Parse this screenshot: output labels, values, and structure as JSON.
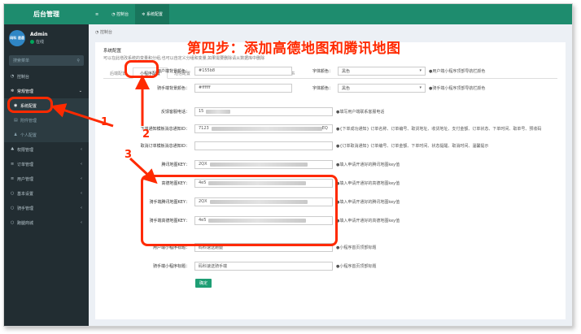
{
  "app": {
    "title": "后台管理"
  },
  "user": {
    "avatar_text": "码科 速通",
    "name": "Admin",
    "status": "在线"
  },
  "sidebar": {
    "search_placeholder": "搜索菜单",
    "items": [
      {
        "label": "控制台",
        "icon": "dashboard-icon"
      },
      {
        "label": "常规管理",
        "icon": "gears-icon"
      },
      {
        "label": "系统配置",
        "icon": "circle-icon"
      },
      {
        "label": "附件管理",
        "icon": "file-icon"
      },
      {
        "label": "个人配置",
        "icon": "user-icon"
      },
      {
        "label": "权限管理",
        "icon": "group-icon"
      },
      {
        "label": "订单管理",
        "icon": "list-icon"
      },
      {
        "label": "用户管理",
        "icon": "list-icon"
      },
      {
        "label": "基本设置",
        "icon": "circle-icon"
      },
      {
        "label": "骑手管理",
        "icon": "circle-icon"
      },
      {
        "label": "跑腿商城",
        "icon": "circle-icon"
      }
    ]
  },
  "header": {
    "tabs": [
      {
        "label": "控制台"
      },
      {
        "label": "系统配置"
      }
    ]
  },
  "breadcrumb": "控制台",
  "panel": {
    "title": "系统配置",
    "desc": "可以在此增改系统的变量和分组,也可以自定义分组和变量,如果需要删除请从数据库中删除",
    "tabs": [
      "后端配置",
      "小程序配置",
      "短信配置",
      "其他配置",
      "骑手端小程序模版",
      "短信证书"
    ]
  },
  "form": {
    "rows": [
      {
        "label": "用户端背景颜色：",
        "value": "#155b8",
        "sel_label": "字体颜色：",
        "sel_value": "黑色",
        "hint": "用户端小程序顶部导航栏颜色"
      },
      {
        "label": "骑手端背景颜色：",
        "value": "#ffffff",
        "sel_label": "字体颜色：",
        "sel_value": "黑色",
        "hint": "骑手端小程序顶部导航栏颜色"
      },
      {
        "label": "反馈客服电话：",
        "value": "15",
        "hint": "填写用户端联系客服电话"
      },
      {
        "label": "下单通知模板消息通知ID：",
        "value": "7123",
        "value_tail": "EQ",
        "hint": "{下单成功通知} 订单名称、订单编号、取货地址、收货地址、支付金额、订单状态、下单时间、取单号、预收码"
      },
      {
        "label": "取消订单模板消息通知ID：",
        "value": "",
        "hint": "{订单取消通知} 订单编号、订单金额、下单时间、状态提醒、取消时间、温馨提示"
      },
      {
        "label": "腾讯地图KEY：",
        "value": "2QX",
        "hint": "填入申请开通好的腾讯地图key值"
      },
      {
        "label": "高德地图KEY：",
        "value": "4e5",
        "hint": "填入申请开通好的高德地图key值"
      },
      {
        "label": "骑手端腾讯地图KEY：",
        "value": "2QX",
        "hint": "填入申请开通好的腾讯地图key值"
      },
      {
        "label": "骑手端高德地图KEY：",
        "value": "4e5",
        "hint": "填入申请开通好的高德地图key值"
      },
      {
        "label": "用户端小程序标题：",
        "value": "码科速送跑腿",
        "hint": "小程序首页顶部标题"
      },
      {
        "label": "骑手端小程序标题：",
        "value": "码科速送骑手端",
        "hint": "小程序首页顶部标题"
      }
    ],
    "submit_label": "确定"
  },
  "annotation": {
    "title": "第四步：添加高德地图和腾讯地图",
    "step1": "1",
    "step2": "2",
    "step3": "3",
    "color": "#ff2a00"
  }
}
